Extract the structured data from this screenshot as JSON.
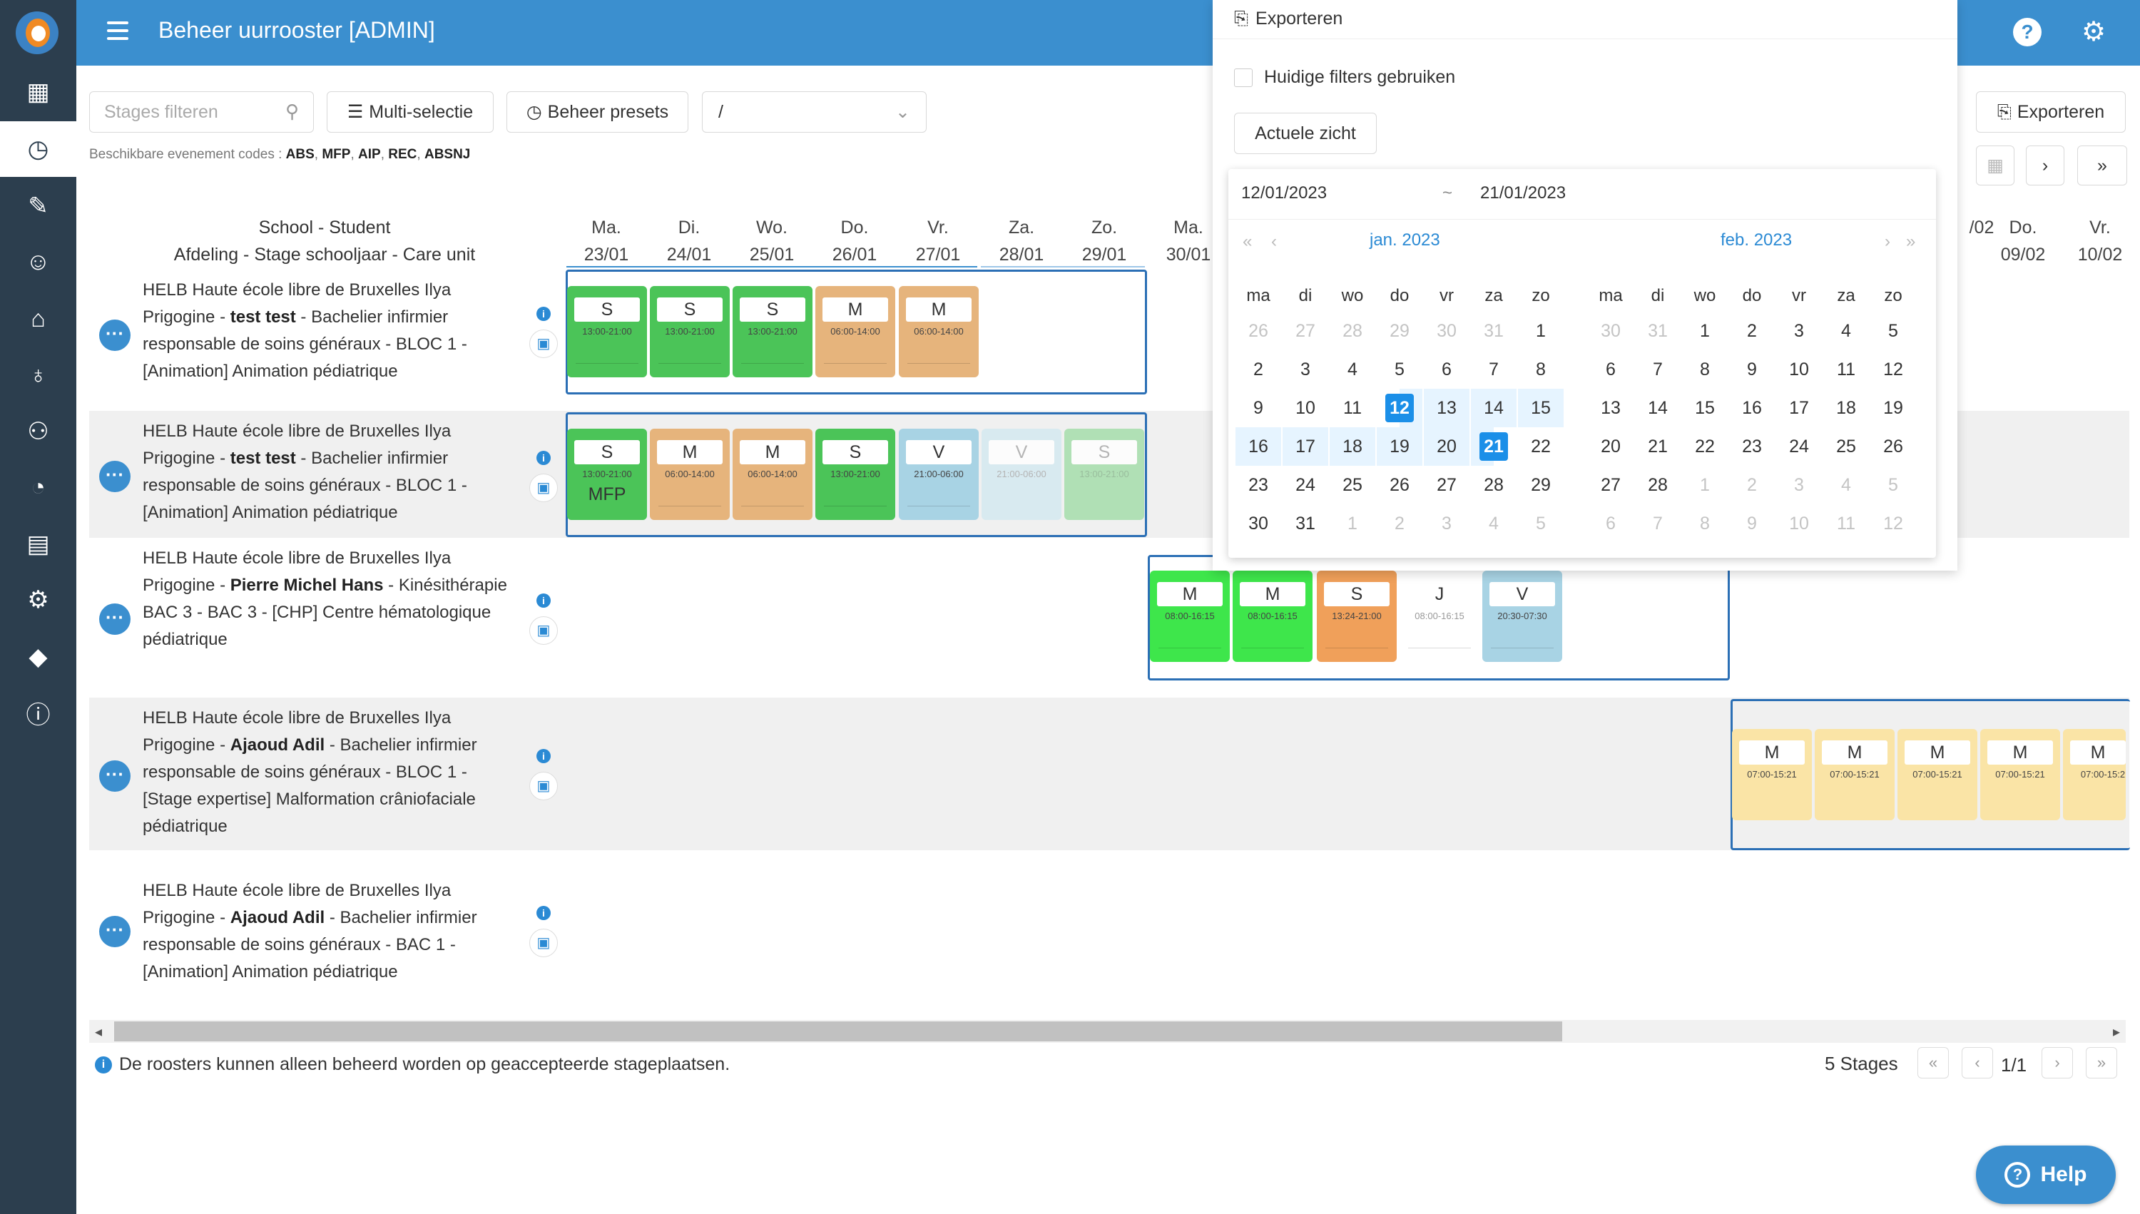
{
  "app": {
    "title": "Beheer uurrooster [ADMIN]"
  },
  "toolbar": {
    "filter_placeholder": "Stages filteren",
    "multi_select": "Multi-selectie",
    "presets": "Beheer presets",
    "preset_value": "/",
    "export_label": "Exporteren"
  },
  "codes": {
    "prefix": "Beschikbare evenement codes :",
    "list": [
      "ABS",
      "MFP",
      "AIP",
      "REC",
      "ABSNJ"
    ]
  },
  "grid": {
    "header_line1": "School - Student",
    "header_line2": "Afdeling - Stage schooljaar - Care unit",
    "days": [
      {
        "d": "Ma.",
        "date": "23/01"
      },
      {
        "d": "Di.",
        "date": "24/01"
      },
      {
        "d": "Wo.",
        "date": "25/01"
      },
      {
        "d": "Do.",
        "date": "26/01"
      },
      {
        "d": "Vr.",
        "date": "27/01"
      },
      {
        "d": "Za.",
        "date": "28/01"
      },
      {
        "d": "Zo.",
        "date": "29/01"
      },
      {
        "d": "Ma.",
        "date": "30/01"
      }
    ],
    "days_right": [
      {
        "d": "",
        "date": "/02"
      },
      {
        "d": "Do.",
        "date": "09/02"
      },
      {
        "d": "Vr.",
        "date": "10/02"
      }
    ]
  },
  "rows": [
    {
      "pre": "HELB Haute école libre de Bruxelles Ilya Prigogine - ",
      "name": "test test",
      "post": " - Bachelier infirmier responsable de soins généraux - BLOC 1 - [Animation] Animation pédiatrique"
    },
    {
      "pre": "HELB Haute école libre de Bruxelles Ilya Prigogine - ",
      "name": "test test",
      "post": " - Bachelier infirmier responsable de soins généraux - BLOC 1 - [Animation] Animation pédiatrique"
    },
    {
      "pre": "HELB Haute école libre de Bruxelles Ilya Prigogine - ",
      "name": "Pierre Michel Hans",
      "post": " - Kinésithérapie BAC 3 - BAC 3 - [CHP] Centre hématologique pédiatrique"
    },
    {
      "pre": "HELB Haute école libre de Bruxelles Ilya Prigogine - ",
      "name": "Ajaoud Adil",
      "post": " - Bachelier infirmier responsable de soins généraux - BLOC 1 - [Stage expertise] Malformation crâniofaciale pédiatrique"
    },
    {
      "pre": "HELB Haute école libre de Bruxelles Ilya Prigogine - ",
      "name": "Ajaoud Adil",
      "post": " - Bachelier infirmier responsable de soins généraux - BAC 1 - [Animation] Animation pédiatrique"
    }
  ],
  "shifts": {
    "row1": [
      {
        "code": "S",
        "time": "13:00-21:00"
      },
      {
        "code": "S",
        "time": "13:00-21:00"
      },
      {
        "code": "S",
        "time": "13:00-21:00"
      },
      {
        "code": "M",
        "time": "06:00-14:00"
      },
      {
        "code": "M",
        "time": "06:00-14:00"
      }
    ],
    "row2": [
      {
        "code": "S",
        "time": "13:00-21:00",
        "extra": "MFP"
      },
      {
        "code": "M",
        "time": "06:00-14:00"
      },
      {
        "code": "M",
        "time": "06:00-14:00"
      },
      {
        "code": "S",
        "time": "13:00-21:00"
      },
      {
        "code": "V",
        "time": "21:00-06:00"
      },
      {
        "code": "V",
        "time": "21:00-06:00"
      },
      {
        "code": "S",
        "time": "13:00-21:00"
      }
    ],
    "row3": [
      {
        "code": "M",
        "time": "08:00-16:15"
      },
      {
        "code": "M",
        "time": "08:00-16:15"
      },
      {
        "code": "S",
        "time": "13:24-21:00"
      },
      {
        "code": "J",
        "time": "08:00-16:15"
      },
      {
        "code": "V",
        "time": "20:30-07:30"
      }
    ],
    "row4": [
      {
        "code": "M",
        "time": "07:00-15:21"
      },
      {
        "code": "M",
        "time": "07:00-15:21"
      },
      {
        "code": "M",
        "time": "07:00-15:21"
      },
      {
        "code": "M",
        "time": "07:00-15:21"
      },
      {
        "code": "M",
        "time": "07:00-15:2"
      }
    ]
  },
  "export_popup": {
    "title": "Exporteren",
    "checkbox_label": "Huidige filters gebruiken",
    "actuele": "Actuele zicht",
    "range_start": "12/01/2023",
    "range_sep": "~",
    "range_end": "21/01/2023",
    "month_left": "jan. 2023",
    "month_right": "feb. 2023",
    "weekdays": [
      "ma",
      "di",
      "wo",
      "do",
      "vr",
      "za",
      "zo"
    ],
    "jan_days": [
      [
        "26",
        "27",
        "28",
        "29",
        "30",
        "31",
        "1"
      ],
      [
        "2",
        "3",
        "4",
        "5",
        "6",
        "7",
        "8"
      ],
      [
        "9",
        "10",
        "11",
        "12",
        "13",
        "14",
        "15"
      ],
      [
        "16",
        "17",
        "18",
        "19",
        "20",
        "21",
        "22"
      ],
      [
        "23",
        "24",
        "25",
        "26",
        "27",
        "28",
        "29"
      ],
      [
        "30",
        "31",
        "1",
        "2",
        "3",
        "4",
        "5"
      ]
    ],
    "feb_days": [
      [
        "30",
        "31",
        "1",
        "2",
        "3",
        "4",
        "5"
      ],
      [
        "6",
        "7",
        "8",
        "9",
        "10",
        "11",
        "12"
      ],
      [
        "13",
        "14",
        "15",
        "16",
        "17",
        "18",
        "19"
      ],
      [
        "20",
        "21",
        "22",
        "23",
        "24",
        "25",
        "26"
      ],
      [
        "27",
        "28",
        "1",
        "2",
        "3",
        "4",
        "5"
      ],
      [
        "6",
        "7",
        "8",
        "9",
        "10",
        "11",
        "12"
      ]
    ]
  },
  "footer": {
    "note": "De roosters kunnen alleen beheerd worden op geaccepteerde stageplaatsen.",
    "stages": "5 Stages",
    "page": "1/1",
    "help": "Help"
  },
  "colors": {
    "primary": "#3b8fcf",
    "sidebar": "#2c3e4e",
    "selected": "#1b8fe8"
  }
}
